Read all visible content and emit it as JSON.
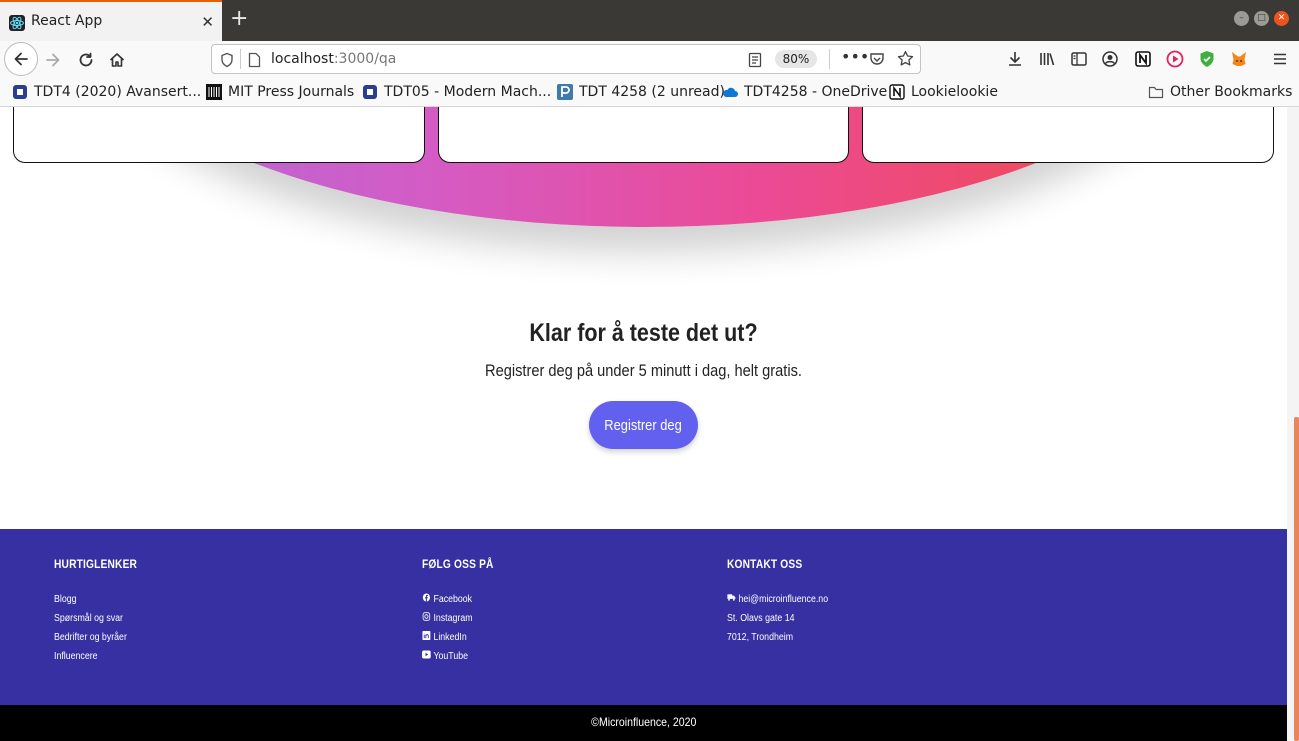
{
  "browser": {
    "tab_title": "React App",
    "url_host": "localhost",
    "url_path": ":3000/qa",
    "zoom": "80%",
    "bookmarks": [
      {
        "label": "TDT4 (2020) Avansert..."
      },
      {
        "label": "MIT Press Journals"
      },
      {
        "label": "TDT05 - Modern Mach..."
      },
      {
        "label": "TDT 4258 (2 unread)"
      },
      {
        "label": "TDT4258 - OneDrive"
      },
      {
        "label": "Lookielookie"
      }
    ],
    "other_bookmarks": "Other Bookmarks"
  },
  "cta": {
    "title": "Klar for å teste det ut?",
    "subtitle": "Registrer deg på under 5 minutt i dag, helt gratis.",
    "button": "Registrer deg"
  },
  "footer": {
    "quicklinks": {
      "heading": "HURTIGLENKER",
      "items": [
        "Blogg",
        "Spørsmål og svar",
        "Bedrifter og byråer",
        "Influencere"
      ]
    },
    "follow": {
      "heading": "FØLG OSS PÅ",
      "items": [
        "Facebook",
        "Instagram",
        "LinkedIn",
        "YouTube"
      ]
    },
    "contact": {
      "heading": "KONTAKT OSS",
      "items": [
        "hei@microinfluence.no",
        "St. Olavs gate 14",
        "7012, Trondheim"
      ]
    },
    "copyright": "©Microinfluence, 2020"
  },
  "colors": {
    "footer_bg": "#3730a3",
    "cta_button": "#6260ef",
    "gradient_start": "#b06ad8",
    "gradient_end": "#ef4a55"
  }
}
